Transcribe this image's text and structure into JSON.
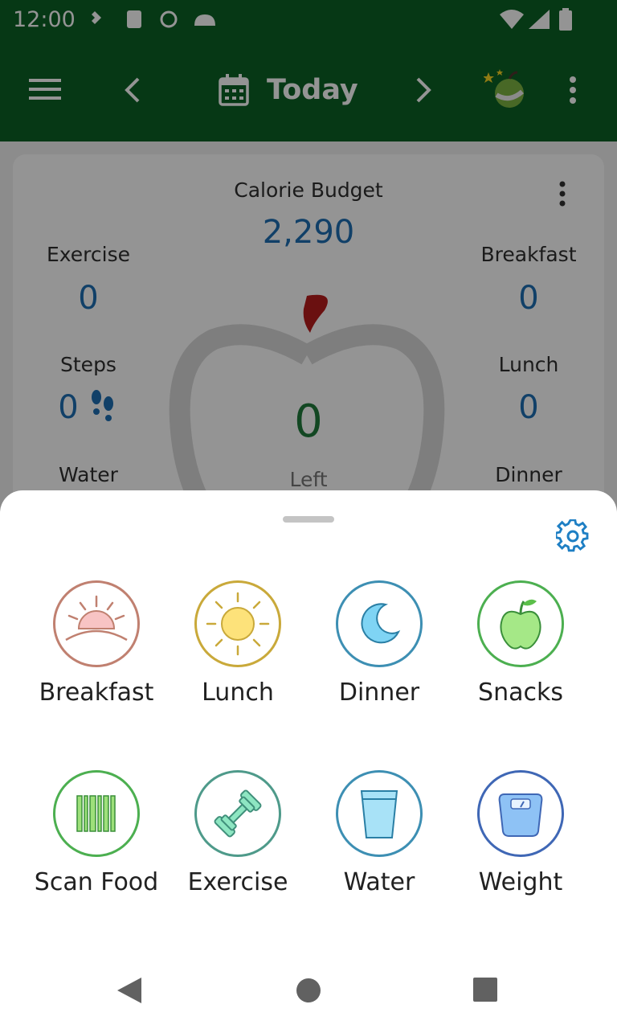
{
  "status_bar": {
    "time": "12:00"
  },
  "app_bar": {
    "title": "Today"
  },
  "summary": {
    "calorie_budget_label": "Calorie Budget",
    "calorie_budget_value": "2,290",
    "left_value": "0",
    "left_label": "Left",
    "exercise_label": "Exercise",
    "exercise_value": "0",
    "steps_label": "Steps",
    "steps_value": "0",
    "water_label": "Water",
    "breakfast_label": "Breakfast",
    "breakfast_value": "0",
    "lunch_label": "Lunch",
    "lunch_value": "0",
    "dinner_label": "Dinner"
  },
  "sheet": {
    "items": [
      {
        "label": "Breakfast",
        "icon": "sunrise-icon",
        "color": "#c08070"
      },
      {
        "label": "Lunch",
        "icon": "sun-icon",
        "color": "#c9a93a"
      },
      {
        "label": "Dinner",
        "icon": "moon-icon",
        "color": "#3d8fb3"
      },
      {
        "label": "Snacks",
        "icon": "apple-icon",
        "color": "#4caf50"
      },
      {
        "label": "Scan Food",
        "icon": "barcode-icon",
        "color": "#4caf50"
      },
      {
        "label": "Exercise",
        "icon": "dumbbell-icon",
        "color": "#4e9a8a"
      },
      {
        "label": "Water",
        "icon": "glass-icon",
        "color": "#3d8fb3"
      },
      {
        "label": "Weight",
        "icon": "scale-icon",
        "color": "#3f67b5"
      }
    ]
  },
  "colors": {
    "primary": "#0b6125",
    "accent": "#1e6fb4",
    "left_value": "#1f7a3b"
  }
}
